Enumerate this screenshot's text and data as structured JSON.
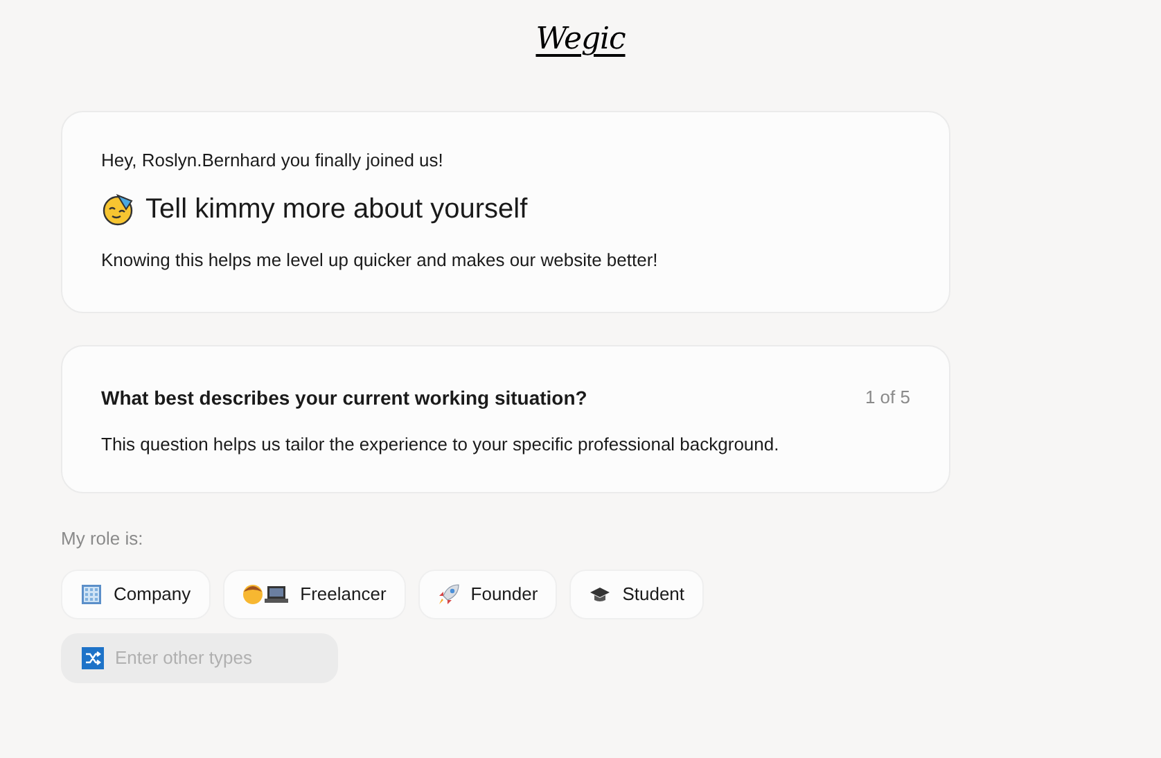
{
  "logo": "Wegic",
  "intro": {
    "greeting": "Hey, Roslyn.Bernhard you finally joined us!",
    "title": "Tell kimmy more about yourself",
    "subtitle": "Knowing this helps me level up quicker and makes our website better!"
  },
  "question": {
    "title": "What best describes your current working situation?",
    "progress": "1 of 5",
    "description": "This question helps us tailor the experience to your specific professional background."
  },
  "role_label": "My role is:",
  "roles": [
    {
      "label": "Company",
      "selected": false
    },
    {
      "label": "Freelancer",
      "selected": false
    },
    {
      "label": "Founder",
      "selected": false
    },
    {
      "label": "Student",
      "selected": false
    }
  ],
  "other": {
    "placeholder": "Enter other types"
  }
}
